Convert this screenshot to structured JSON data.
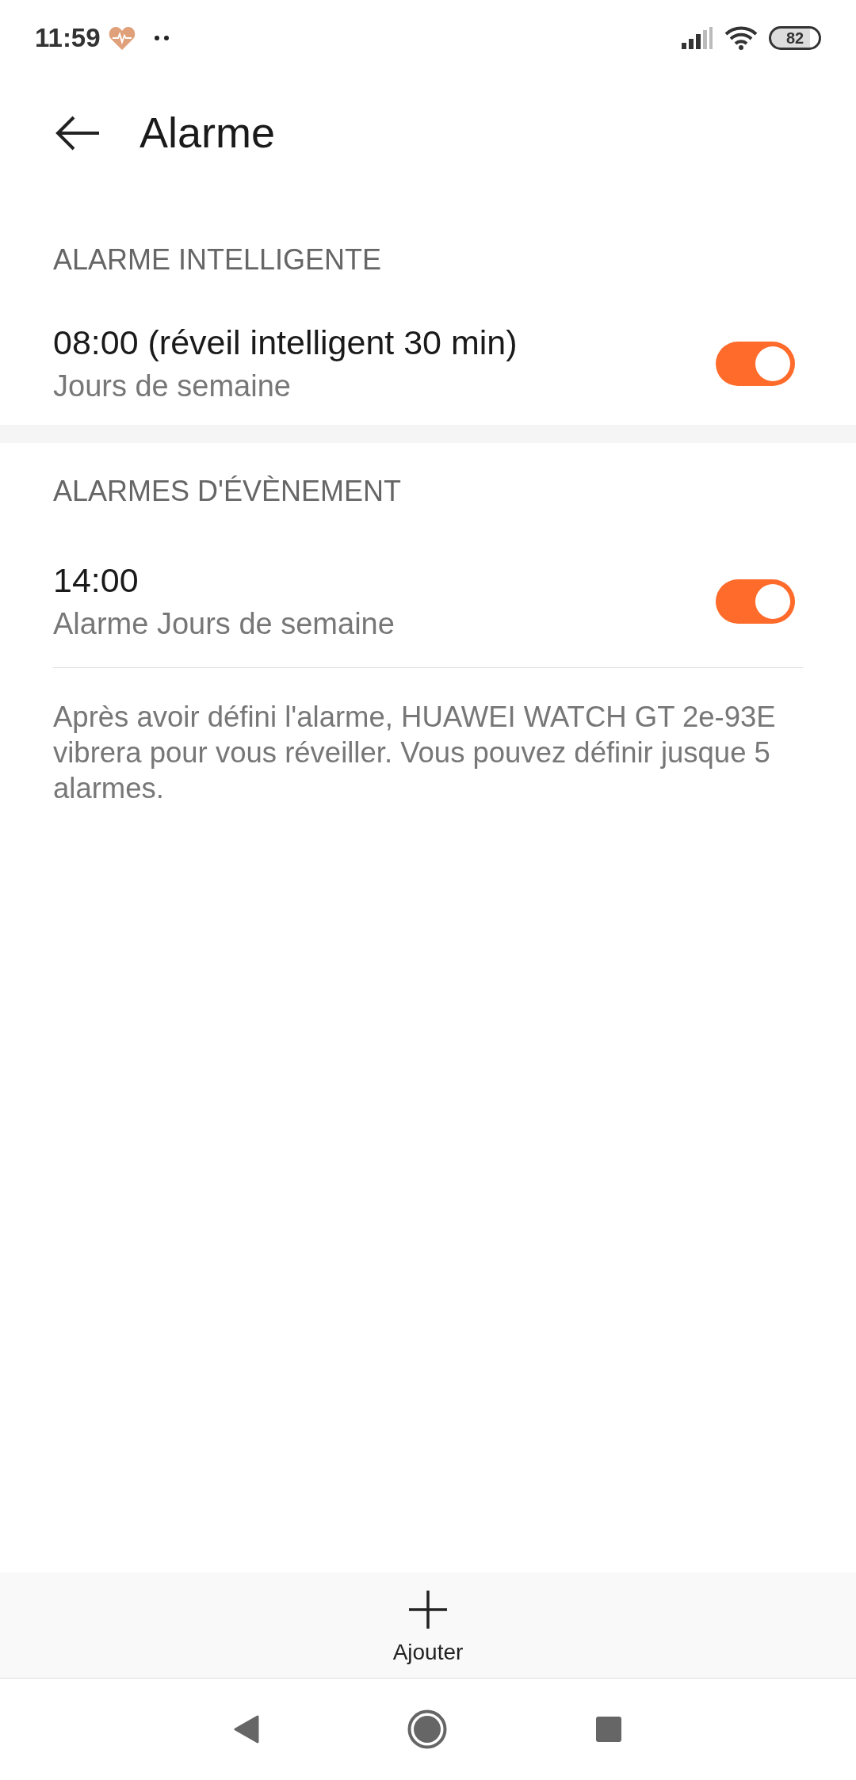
{
  "status_bar": {
    "time": "11:59",
    "battery": "82"
  },
  "header": {
    "title": "Alarme"
  },
  "sections": [
    {
      "title": "ALARME INTELLIGENTE",
      "alarms": [
        {
          "title": "08:00 (réveil intelligent 30 min)",
          "subtitle": "Jours de semaine",
          "on": true
        }
      ]
    },
    {
      "title": "ALARMES D'ÉVÈNEMENT",
      "alarms": [
        {
          "title": "14:00",
          "subtitle": "Alarme Jours de semaine",
          "on": true
        }
      ]
    }
  ],
  "note": "Après avoir défini l'alarme, HUAWEI WATCH GT 2e-93E vibrera pour vous réveiller. Vous pouvez définir jusque 5 alarmes.",
  "add_button": {
    "label": "Ajouter"
  }
}
